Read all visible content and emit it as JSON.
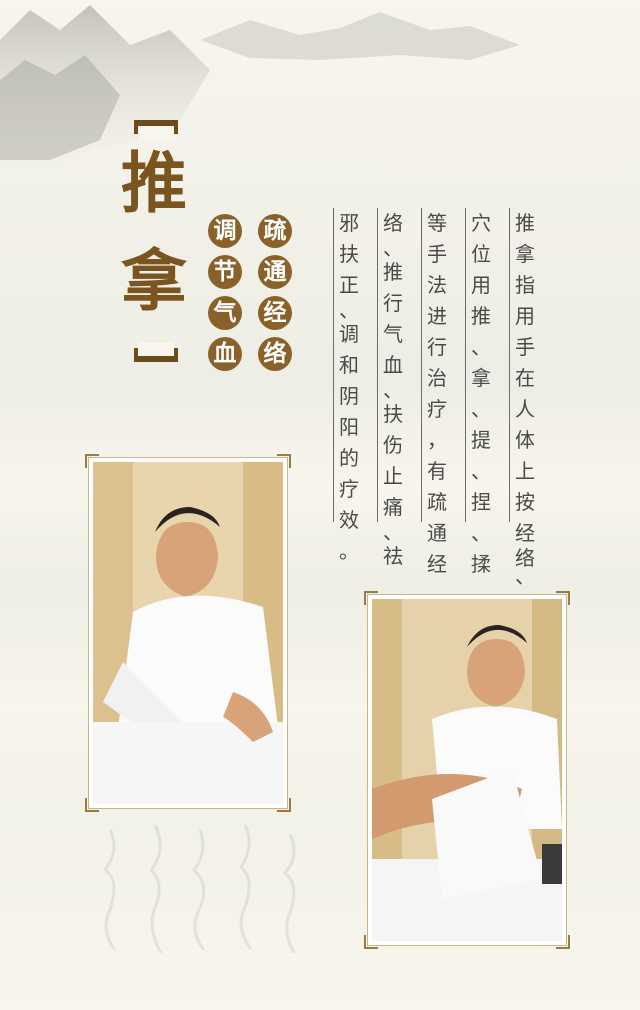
{
  "title": {
    "char1": "推",
    "char2": "拿"
  },
  "subtitle": {
    "column1": [
      "疏",
      "通",
      "经",
      "络"
    ],
    "column2": [
      "调",
      "节",
      "气",
      "血"
    ]
  },
  "description_columns": [
    [
      "推",
      "拿",
      "指",
      "用",
      "手",
      "在",
      "人",
      "体",
      "上",
      "按",
      "经",
      "络",
      "、"
    ],
    [
      "穴",
      "位",
      "用",
      "推",
      "、",
      "拿",
      "、",
      "提",
      "、",
      "捏",
      "、",
      "揉"
    ],
    [
      "等",
      "手",
      "法",
      "进",
      "行",
      "治",
      "疗",
      "，",
      "有",
      "疏",
      "通",
      "经"
    ],
    [
      "络",
      "、",
      "推",
      "行",
      "气",
      "血",
      "、",
      "扶",
      "伤",
      "止",
      "痛",
      "、",
      "祛"
    ],
    [
      "邪",
      "扶",
      "正",
      "、",
      "调",
      "和",
      "阴",
      "阳",
      "的",
      "疗",
      "效",
      "。"
    ]
  ],
  "colors": {
    "accent": "#8a6229",
    "title": "#7a5520",
    "text": "#4a4a4a",
    "background": "#f7f5ec"
  },
  "images": [
    {
      "name": "massage-photo-back",
      "description": "therapist in white coat massaging patient's back"
    },
    {
      "name": "massage-photo-leg",
      "description": "therapist stretching patient's leg"
    }
  ]
}
